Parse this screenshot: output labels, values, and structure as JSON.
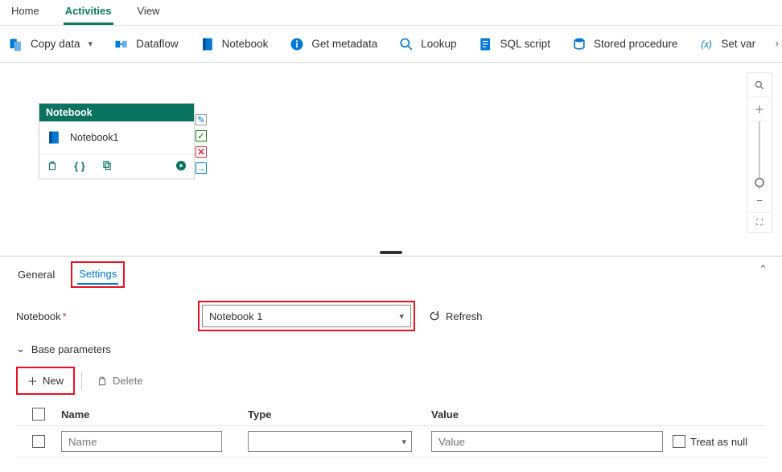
{
  "topnav": {
    "items": [
      "Home",
      "Activities",
      "View"
    ],
    "active": "Activities"
  },
  "ribbon": {
    "items": [
      {
        "label": "Copy data",
        "icon": "copy-data"
      },
      {
        "label": "Dataflow",
        "icon": "dataflow"
      },
      {
        "label": "Notebook",
        "icon": "notebook"
      },
      {
        "label": "Get metadata",
        "icon": "info"
      },
      {
        "label": "Lookup",
        "icon": "search"
      },
      {
        "label": "SQL script",
        "icon": "sql"
      },
      {
        "label": "Stored procedure",
        "icon": "sproc"
      },
      {
        "label": "Set var",
        "icon": "setvar"
      }
    ]
  },
  "node": {
    "type_label": "Notebook",
    "name": "Notebook1"
  },
  "panel": {
    "tabs": [
      "General",
      "Settings"
    ],
    "active": "Settings",
    "notebook_field_label": "Notebook",
    "notebook_selected": "Notebook 1",
    "refresh_label": "Refresh",
    "base_params_label": "Base parameters",
    "new_label": "New",
    "delete_label": "Delete",
    "columns": {
      "name": "Name",
      "type": "Type",
      "value": "Value",
      "null": "Treat as null"
    },
    "row_placeholders": {
      "name": "Name",
      "value": "Value"
    }
  }
}
